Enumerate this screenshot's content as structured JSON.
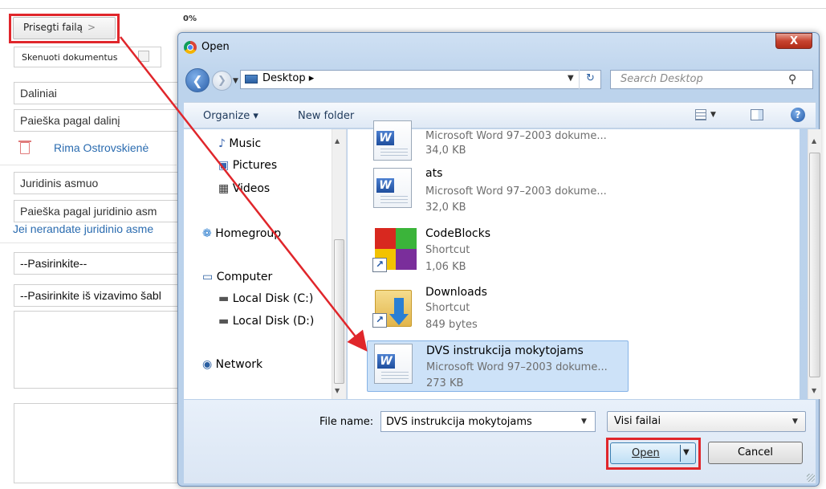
{
  "page": {
    "attach_button": "Prisegti failą",
    "attach_chevron": ">",
    "progress_text": "0%",
    "scan_button": "Skenuoti dokumentus",
    "field_division": "Daliniai",
    "field_division_search": "Paieška pagal dalinį",
    "person_name": "Rima Ostrovskienė",
    "field_legal_person": "Juridinis asmuo",
    "field_legal_search": "Paieška pagal juridinio asm",
    "legal_hint_link": "Jei nerandate juridinio asme",
    "select_choose": "--Pasirinkite--",
    "select_template": "--Pasirinkite iš vizavimo šabl"
  },
  "dialog": {
    "title": "Open",
    "close_glyph": "X",
    "address": "Desktop",
    "address_sep": "▸",
    "search_placeholder": "Search Desktop",
    "toolbar": {
      "organize": "Organize ▾",
      "new_folder": "New folder",
      "help": "?"
    },
    "nav_items": [
      {
        "label": "Music",
        "icon": "music-icon"
      },
      {
        "label": "Pictures",
        "icon": "pictures-icon"
      },
      {
        "label": "Videos",
        "icon": "videos-icon"
      },
      {
        "label": "Homegroup",
        "icon": "homegroup-icon"
      },
      {
        "label": "Computer",
        "icon": "computer-icon"
      },
      {
        "label": "Local Disk (C:)",
        "icon": "local-disk-icon"
      },
      {
        "label": "Local Disk (D:)",
        "icon": "local-disk-icon"
      },
      {
        "label": "Network",
        "icon": "network-icon"
      }
    ],
    "files": [
      {
        "name": "",
        "type": "Microsoft Word 97–2003 dokume...",
        "size": "34,0 KB"
      },
      {
        "name": "ats",
        "type": "Microsoft Word 97–2003 dokume...",
        "size": "32,0 KB"
      },
      {
        "name": "CodeBlocks",
        "type": "Shortcut",
        "size": "1,06 KB"
      },
      {
        "name": "Downloads",
        "type": "Shortcut",
        "size": "849 bytes"
      },
      {
        "name": "DVS instrukcija mokytojams",
        "type": "Microsoft Word 97–2003 dokume...",
        "size": "273 KB",
        "selected": true
      }
    ],
    "file_name_label": "File name:",
    "file_name_value": "DVS instrukcija mokytojams",
    "file_type_value": "Visi failai",
    "open_button": "Open",
    "cancel_button": "Cancel"
  },
  "colors": {
    "annotation_red": "#e0262b",
    "link_blue": "#2b6cb0",
    "selection": "#cde2f8"
  }
}
